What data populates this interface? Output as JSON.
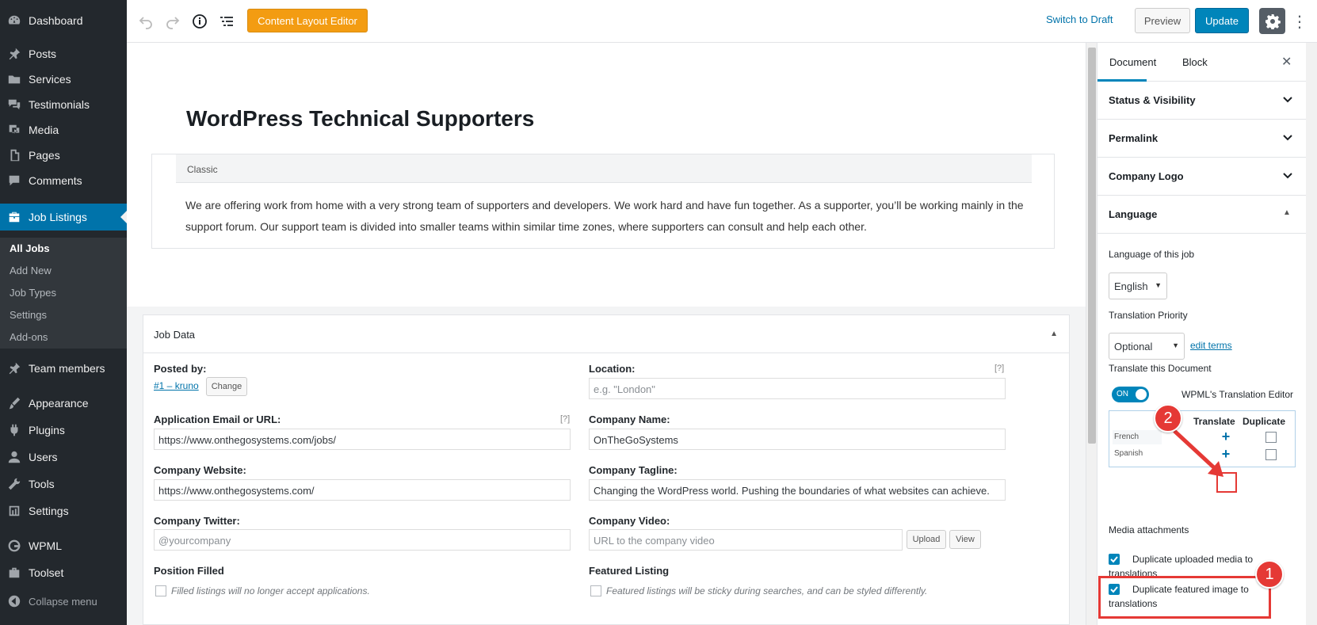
{
  "admin_menu": {
    "items": [
      {
        "label": "Dashboard",
        "icon": "dashboard-icon"
      },
      {
        "label": "Posts",
        "icon": "pin-icon"
      },
      {
        "label": "Services",
        "icon": "folder-icon"
      },
      {
        "label": "Testimonials",
        "icon": "comments-icon"
      },
      {
        "label": "Media",
        "icon": "media-icon"
      },
      {
        "label": "Pages",
        "icon": "pages-icon"
      },
      {
        "label": "Comments",
        "icon": "comment-icon"
      },
      {
        "label": "Job Listings",
        "icon": "briefcase-icon"
      },
      {
        "label": "Team members",
        "icon": "pin-icon"
      },
      {
        "label": "Appearance",
        "icon": "brush-icon"
      },
      {
        "label": "Plugins",
        "icon": "plugin-icon"
      },
      {
        "label": "Users",
        "icon": "user-icon"
      },
      {
        "label": "Tools",
        "icon": "wrench-icon"
      },
      {
        "label": "Settings",
        "icon": "settings-icon"
      },
      {
        "label": "WPML",
        "icon": "wpml-icon"
      },
      {
        "label": "Toolset",
        "icon": "toolset-icon"
      },
      {
        "label": "Collapse menu",
        "icon": "collapse-icon"
      }
    ],
    "active": "Job Listings",
    "submenu": [
      "All Jobs",
      "Add New",
      "Job Types",
      "Settings",
      "Add-ons"
    ]
  },
  "toolbar": {
    "content_layout_editor": "Content Layout Editor",
    "switch_to_draft": "Switch to Draft",
    "preview": "Preview",
    "update": "Update"
  },
  "editor": {
    "title": "WordPress Technical Supporters",
    "classic_label": "Classic",
    "body_text": "We are offering work from home with a very strong team of supporters and developers. We work hard and have fun together. As a supporter, you’ll be working mainly in the support forum. Our support team is divided into smaller teams within similar time zones, where supporters can consult and help each other."
  },
  "job_data": {
    "title": "Job Data",
    "posted_by_label": "Posted by:",
    "posted_by_value": "#1 – kruno",
    "change_button": "Change",
    "location_label": "Location:",
    "location_help": "[?]",
    "location_placeholder": "e.g. \"London\"",
    "app_email_label": "Application Email or URL:",
    "app_email_help": "[?]",
    "app_email_value": "https://www.onthegosystems.com/jobs/",
    "company_name_label": "Company Name:",
    "company_name_value": "OnTheGoSystems",
    "company_website_label": "Company Website:",
    "company_website_value": "https://www.onthegosystems.com/",
    "company_tagline_label": "Company Tagline:",
    "company_tagline_value": "Changing the WordPress world. Pushing the boundaries of what websites can achieve.",
    "company_twitter_label": "Company Twitter:",
    "company_twitter_placeholder": "@yourcompany",
    "company_video_label": "Company Video:",
    "company_video_placeholder": "URL to the company video",
    "upload_button": "Upload",
    "view_button": "View",
    "position_filled_label": "Position Filled",
    "position_filled_note": "Filled listings will no longer accept applications.",
    "featured_listing_label": "Featured Listing",
    "featured_listing_note": "Featured listings will be sticky during searches, and can be styled differently."
  },
  "sidebar": {
    "tab_document": "Document",
    "tab_block": "Block",
    "panels": [
      "Status & Visibility",
      "Permalink",
      "Company Logo",
      "Language"
    ],
    "language_of_job_label": "Language of this job",
    "language_value": "English",
    "translation_priority_label": "Translation Priority",
    "priority_value": "Optional",
    "edit_terms": "edit terms",
    "translate_doc_label": "Translate this Document",
    "toggle_on": "ON",
    "wpml_te_text": "WPML's Translation Editor",
    "table_head_translate": "Translate",
    "table_head_duplicate": "Duplicate",
    "languages": [
      "French",
      "Spanish"
    ],
    "media_attachments_label": "Media attachments",
    "dup_uploaded_media": "Duplicate uploaded media to translations",
    "dup_featured_image": "Duplicate featured image to translations"
  },
  "annotations": {
    "badge_1": "1",
    "badge_2": "2"
  },
  "colors": {
    "admin_bg": "#23282d",
    "active_blue": "#0073aa",
    "cle_orange": "#f39c12",
    "update_blue": "#0085ba",
    "annotation_red": "#e53935"
  }
}
